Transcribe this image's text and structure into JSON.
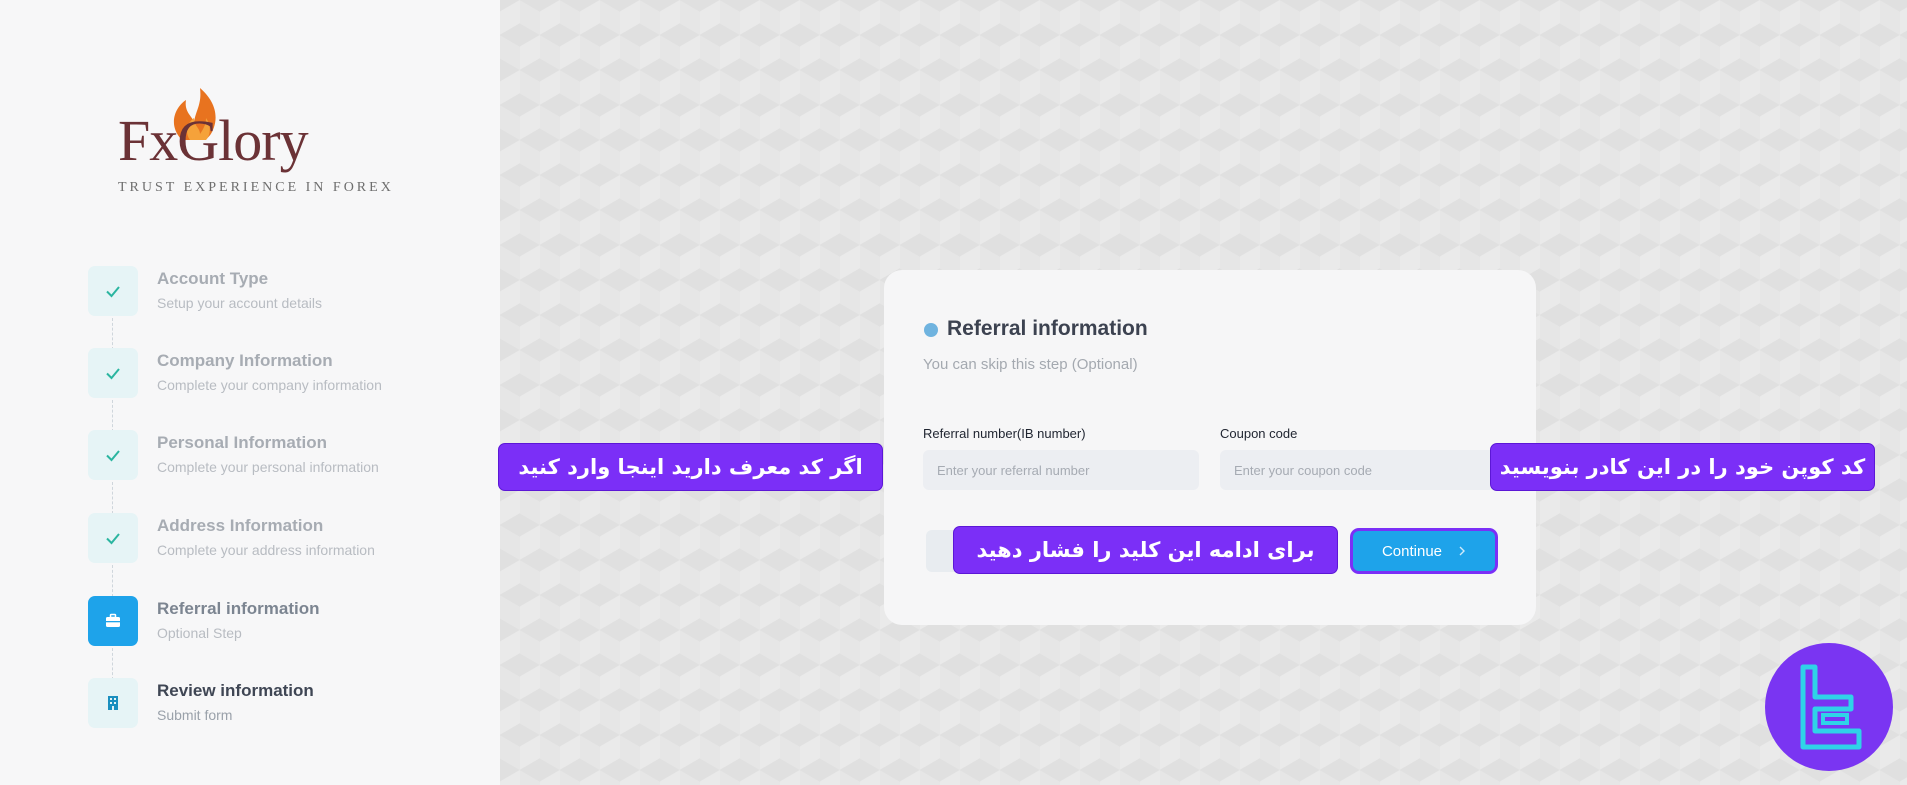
{
  "logo": {
    "name": "FxGlory",
    "tagline": "TRUST EXPERIENCE IN FOREX"
  },
  "steps": [
    {
      "title": "Account Type",
      "subtitle": "Setup your account details",
      "state": "done"
    },
    {
      "title": "Company Information",
      "subtitle": "Complete your company information",
      "state": "done"
    },
    {
      "title": "Personal Information",
      "subtitle": "Complete your personal information",
      "state": "done"
    },
    {
      "title": "Address Information",
      "subtitle": "Complete your address information",
      "state": "done"
    },
    {
      "title": "Referral information",
      "subtitle": "Optional Step",
      "state": "current"
    },
    {
      "title": "Review information",
      "subtitle": "Submit form",
      "state": "upcoming"
    }
  ],
  "card": {
    "title": "Referral information",
    "subtitle": "You can skip this step (Optional)",
    "referral_label": "Referral number(IB number)",
    "referral_placeholder": "Enter your referral number",
    "coupon_label": "Coupon code",
    "coupon_placeholder": "Enter your coupon code",
    "continue_label": "Continue"
  },
  "callouts": {
    "referral": "اگر کد معرف دارید اینجا وارد کنید",
    "coupon": "کد کوپن خود را در این کادر بنویسید",
    "continue": "برای ادامه این کلید را فشار دهید"
  },
  "colors": {
    "accent": "#1ea3ea",
    "callout": "#7b2ff7",
    "done_check": "#2bb5a0"
  }
}
